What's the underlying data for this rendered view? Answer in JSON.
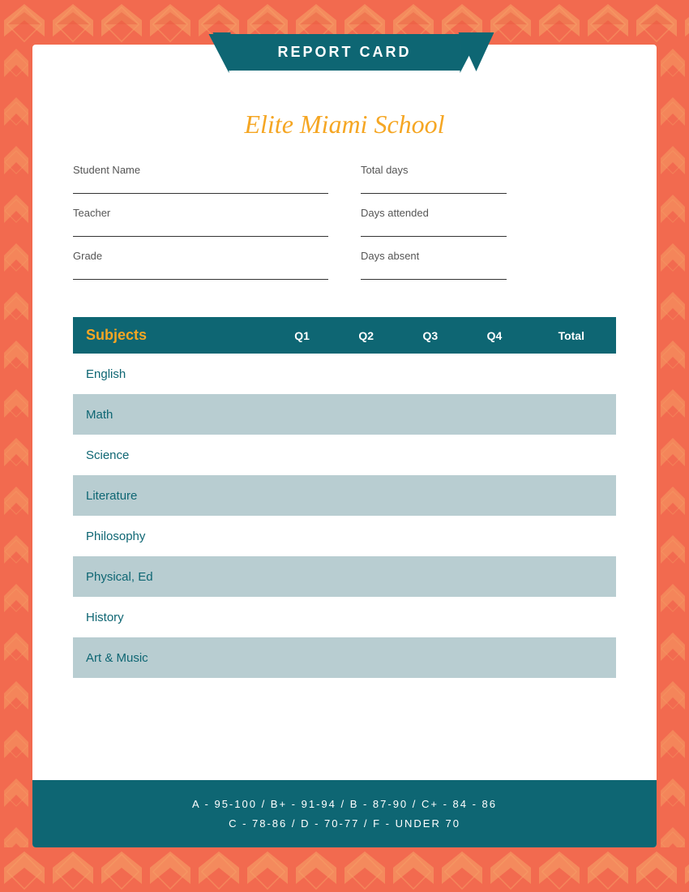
{
  "colors": {
    "teal": "#0e6673",
    "coral": "#f26a4f",
    "gold": "#f5a623",
    "shaded": "#b8cdd1",
    "white": "#ffffff"
  },
  "banner": {
    "label": "REPORT CARD"
  },
  "school": {
    "name": "Elite Miami School"
  },
  "info_fields": {
    "student_name": "Student Name",
    "teacher": "Teacher",
    "grade": "Grade",
    "total_days": "Total days",
    "days_attended": "Days attended",
    "days_absent": "Days absent"
  },
  "table": {
    "headers": {
      "subjects": "Subjects",
      "q1": "Q1",
      "q2": "Q2",
      "q3": "Q3",
      "q4": "Q4",
      "total": "Total"
    },
    "rows": [
      {
        "name": "English",
        "shaded": false
      },
      {
        "name": "Math",
        "shaded": true
      },
      {
        "name": "Science",
        "shaded": false
      },
      {
        "name": "Literature",
        "shaded": true
      },
      {
        "name": "Philosophy",
        "shaded": false
      },
      {
        "name": "Physical, Ed",
        "shaded": true
      },
      {
        "name": "History",
        "shaded": false
      },
      {
        "name": "Art & Music",
        "shaded": true
      }
    ]
  },
  "grading_scale": {
    "line1": "A - 95-100  /  B+ - 91-94  /  B - 87-90  /  C+ - 84 - 86",
    "line2": "C - 78-86  /  D - 70-77  /  F - UNDER 70"
  }
}
